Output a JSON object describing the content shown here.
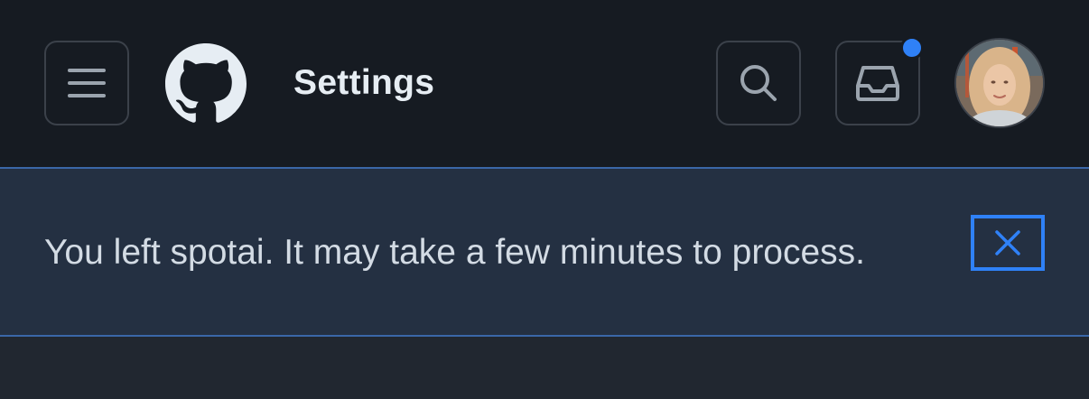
{
  "header": {
    "title": "Settings",
    "icons": {
      "menu": "hamburger-menu-icon",
      "logo": "github-logo-icon",
      "search": "search-icon",
      "inbox": "inbox-icon",
      "avatar": "user-avatar"
    },
    "inbox_has_unread": true
  },
  "banner": {
    "message": "You left spotai. It may take a few minutes to process.",
    "dismiss_icon": "close-icon"
  },
  "colors": {
    "header_bg": "#161b22",
    "banner_bg": "#243042",
    "banner_border": "#3a67a8",
    "accent": "#2f81f7",
    "page_bg": "#212730",
    "text": "#e6edf3"
  }
}
